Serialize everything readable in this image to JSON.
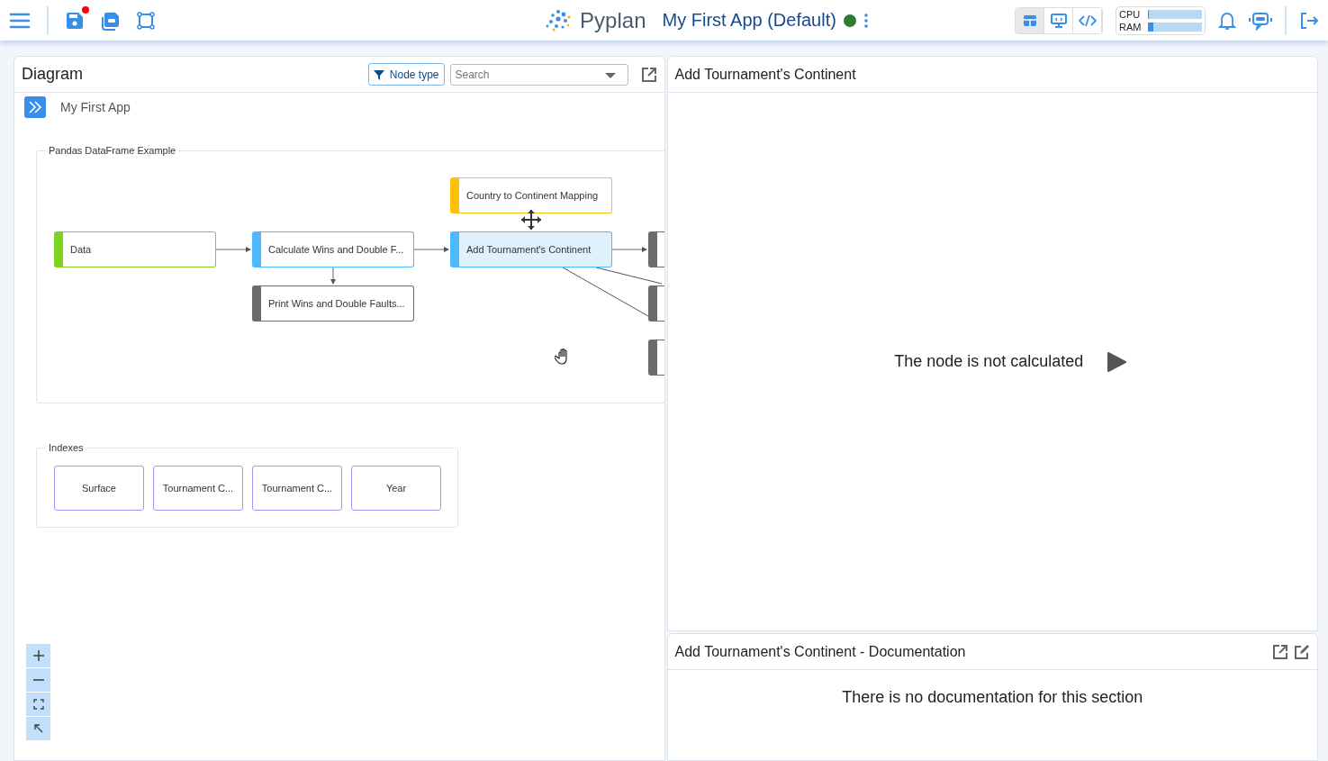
{
  "header": {
    "unsaved": true,
    "brand": "Pyplan",
    "app_title": "My First App (Default)",
    "status": {
      "color": "#2e7d32"
    },
    "views": [
      {
        "kind": "table",
        "selected": true
      },
      {
        "kind": "present",
        "selected": false
      },
      {
        "kind": "code",
        "selected": false
      }
    ],
    "meters": [
      {
        "label": "CPU",
        "level": 0.02
      },
      {
        "label": "RAM",
        "level": 0.1
      }
    ]
  },
  "diagram": {
    "title": "Diagram",
    "filter_button": "Node type",
    "search": {
      "placeholder": "Search"
    },
    "breadcrumb": "My First App",
    "groups": [
      {
        "title": "Pandas DataFrame Example"
      },
      {
        "title": "Indexes"
      }
    ],
    "nodes": [
      {
        "label": "Data",
        "color": "#7ed321",
        "selected": false
      },
      {
        "label": "Calculate Wins and Double F...",
        "color": "#4db8ff",
        "selected": false
      },
      {
        "label": "Print Wins and Double Faults...",
        "color": "#6b6b6b",
        "selected": false
      },
      {
        "label": "Country to Continent Mapping",
        "color": "#ffc107",
        "selected": false
      },
      {
        "label": "Add Tournament's Continent",
        "color": "#4db8ff",
        "selected": true
      },
      {
        "color": "#6b6b6b",
        "selected": false
      },
      {
        "color": "#6b6b6b",
        "selected": false
      },
      {
        "color": "#6b6b6b",
        "selected": false
      }
    ],
    "indexes": [
      {
        "label": "Surface"
      },
      {
        "label": "Tournament C..."
      },
      {
        "label": "Tournament C..."
      },
      {
        "label": "Year"
      }
    ]
  },
  "result": {
    "title": "Add Tournament's Continent",
    "message": "The node is not calculated"
  },
  "documentation": {
    "title": "Add Tournament's Continent - Documentation",
    "message": "There is no documentation for this section"
  }
}
